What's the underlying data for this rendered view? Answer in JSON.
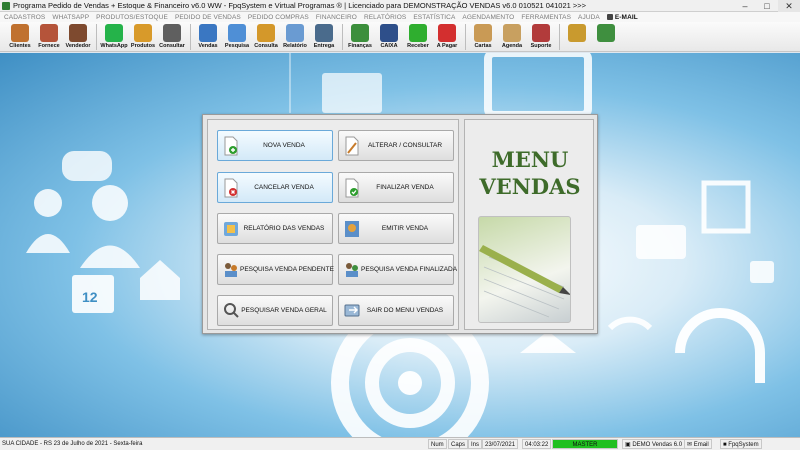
{
  "window": {
    "title": "Programa Pedido de Vendas + Estoque & Financeiro v6.0 WW - FpqSystem e Virtual Programas ® | Licenciado para  DEMONSTRAÇÃO VENDAS v6.0 010521 041021 >>>",
    "minimize": "–",
    "maximize": "□",
    "close": "✕"
  },
  "menubar": [
    "CADASTROS",
    "WHATSAPP",
    "PRODUTOS/ESTOQUE",
    "PEDIDO DE VENDAS",
    "PEDIDO COMPRAS",
    "FINANCEIRO",
    "RELATÓRIOS",
    "ESTATÍSTICA",
    "AGENDAMENTO",
    "FERRAMENTAS",
    "AJUDA"
  ],
  "menubar_email": "E-MAIL",
  "toolbar": [
    {
      "label": "Clientes",
      "icon": "clients-icon",
      "color": "#c0712f"
    },
    {
      "label": "Fornece",
      "icon": "supplier-icon",
      "color": "#b5543a"
    },
    {
      "label": "Vendedor",
      "icon": "seller-icon",
      "color": "#7e4a2f"
    },
    {
      "label": "WhatsApp",
      "icon": "whatsapp-icon",
      "color": "#25b34a"
    },
    {
      "label": "Produtos",
      "icon": "products-icon",
      "color": "#d89a2a"
    },
    {
      "label": "Consultar",
      "icon": "search-icon",
      "color": "#5f5f5f"
    },
    {
      "label": "Vendas",
      "icon": "sales-icon",
      "color": "#3a77c2"
    },
    {
      "label": "Pesquisa",
      "icon": "research-icon",
      "color": "#4f8fd6"
    },
    {
      "label": "Consulta",
      "icon": "query-icon",
      "color": "#d4982a"
    },
    {
      "label": "Relatório",
      "icon": "report-icon",
      "color": "#6a9bd2"
    },
    {
      "label": "Entrega",
      "icon": "delivery-icon",
      "color": "#4a6b8c"
    },
    {
      "label": "Finanças",
      "icon": "finance-icon",
      "color": "#3c8f3c"
    },
    {
      "label": "CAIXA",
      "icon": "cash-icon",
      "color": "#2e4f8a"
    },
    {
      "label": "Receber",
      "icon": "receive-icon",
      "color": "#2fae2f"
    },
    {
      "label": "A Pagar",
      "icon": "pay-icon",
      "color": "#d32f2f"
    },
    {
      "label": "Cartas",
      "icon": "letters-icon",
      "color": "#c99a55"
    },
    {
      "label": "Agenda",
      "icon": "agenda-icon",
      "color": "#c8a060"
    },
    {
      "label": "Suporte",
      "icon": "support-icon",
      "color": "#b23b3b"
    },
    {
      "label": "",
      "icon": "coins-icon",
      "color": "#c99a2e"
    },
    {
      "label": "",
      "icon": "exit-icon",
      "color": "#3f8f3f"
    }
  ],
  "menu_panel": {
    "heading_line1": "MENU",
    "heading_line2": "VENDAS",
    "buttons": [
      {
        "label": "NOVA VENDA",
        "icon": "new-sale-icon",
        "selected": true
      },
      {
        "label": "ALTERAR / CONSULTAR",
        "icon": "edit-pencil-icon",
        "selected": false
      },
      {
        "label": "CANCELAR VENDA",
        "icon": "cancel-sale-icon",
        "selected": true
      },
      {
        "label": "FINALIZAR VENDA",
        "icon": "finalize-sale-icon",
        "selected": false
      },
      {
        "label": "RELATÓRIO DAS VENDAS",
        "icon": "report-icon",
        "selected": false
      },
      {
        "label": "EMITIR VENDA",
        "icon": "emit-sale-icon",
        "selected": false
      },
      {
        "label": "PESQUISA VENDA PENDENTE",
        "icon": "pending-search-icon",
        "selected": false
      },
      {
        "label": "PESQUISA VENDA FINALIZADA",
        "icon": "finished-search-icon",
        "selected": false
      },
      {
        "label": "PESQUISAR VENDA GERAL",
        "icon": "general-search-icon",
        "selected": false
      },
      {
        "label": "SAIR DO MENU VENDAS",
        "icon": "exit-menu-icon",
        "selected": false
      }
    ]
  },
  "background_deco": {
    "calendar_day": "12"
  },
  "statusbar": {
    "city": "SUA CIDADE - RS 23 de Julho de 2021 - Sexta-feira",
    "num": "Num",
    "caps": "Caps",
    "ins": "Ins",
    "date": "23/07/2021",
    "time": "04:03:22",
    "master": "MASTER",
    "demo": "DEMO Vendas 6.0",
    "email": "Email",
    "brand": "FpqSystem"
  }
}
